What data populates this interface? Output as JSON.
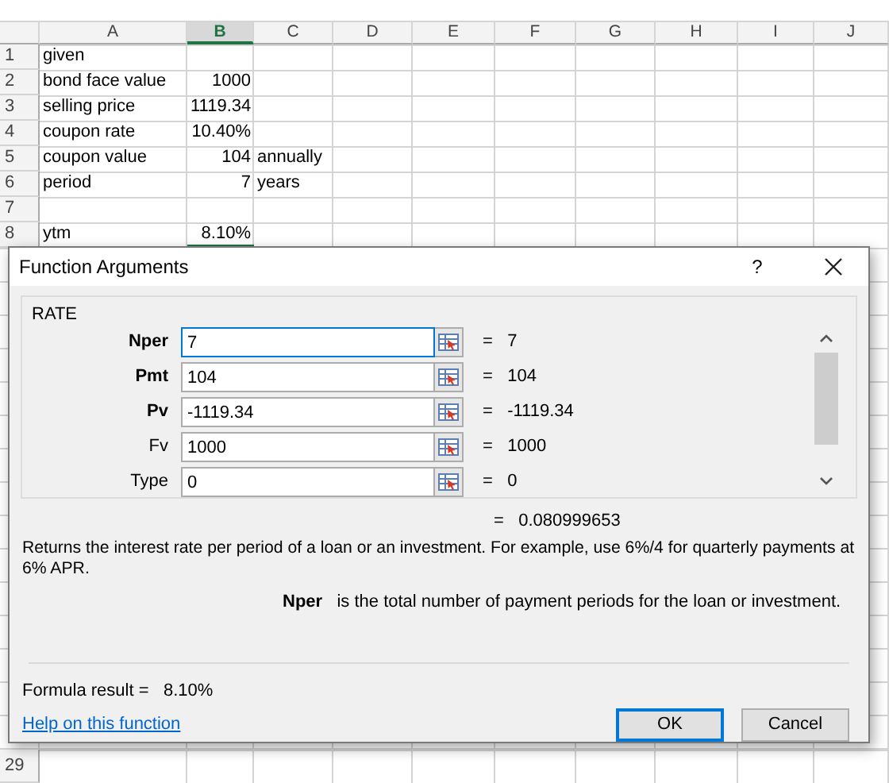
{
  "sheet": {
    "columns": [
      {
        "label": "A",
        "selected": false
      },
      {
        "label": "B",
        "selected": true
      },
      {
        "label": "C",
        "selected": false
      },
      {
        "label": "D",
        "selected": false
      },
      {
        "label": "E",
        "selected": false
      },
      {
        "label": "F",
        "selected": false
      },
      {
        "label": "G",
        "selected": false
      },
      {
        "label": "H",
        "selected": false
      },
      {
        "label": "I",
        "selected": false
      },
      {
        "label": "J",
        "selected": false
      }
    ],
    "rows": [
      {
        "number": "1",
        "a": "given"
      },
      {
        "number": "2",
        "a": "bond face value",
        "b": "1000"
      },
      {
        "number": "3",
        "a": "selling price",
        "b": "1119.34"
      },
      {
        "number": "4",
        "a": "coupon rate",
        "b": "10.40%"
      },
      {
        "number": "5",
        "a": "coupon value",
        "b": "104",
        "c": "annually"
      },
      {
        "number": "6",
        "a": "period",
        "b": "7",
        "c": "years"
      },
      {
        "number": "7"
      },
      {
        "number": "8",
        "a": "ytm",
        "b": "8.10%"
      }
    ],
    "bottom_row": {
      "number": "29"
    }
  },
  "dialog": {
    "title": "Function Arguments",
    "help": "?",
    "function_name": "RATE",
    "arguments": [
      {
        "label": "Nper",
        "required": true,
        "value": "7",
        "focused": true,
        "result": "=   7"
      },
      {
        "label": "Pmt",
        "required": true,
        "value": "104",
        "focused": false,
        "result": "=   104"
      },
      {
        "label": "Pv",
        "required": true,
        "value": "-1119.34",
        "focused": false,
        "result": "=   -1119.34"
      },
      {
        "label": "Fv",
        "required": false,
        "value": "1000",
        "focused": false,
        "result": "=   1000"
      },
      {
        "label": "Type",
        "required": false,
        "value": "0",
        "focused": false,
        "result": "=   0"
      }
    ],
    "result": "=   0.080999653",
    "description": "Returns the interest rate per period of a loan or an investment. For example, use 6%/4 for quarterly payments at 6% APR.",
    "argument_help": "**Nper**   is the total number of payment periods for the loan or investment.",
    "formula_result": "Formula result =   8.10%",
    "help_link": "Help on this function",
    "buttons": [
      {
        "label": "OK",
        "default": true
      },
      {
        "label": "Cancel",
        "default": false
      }
    ]
  }
}
